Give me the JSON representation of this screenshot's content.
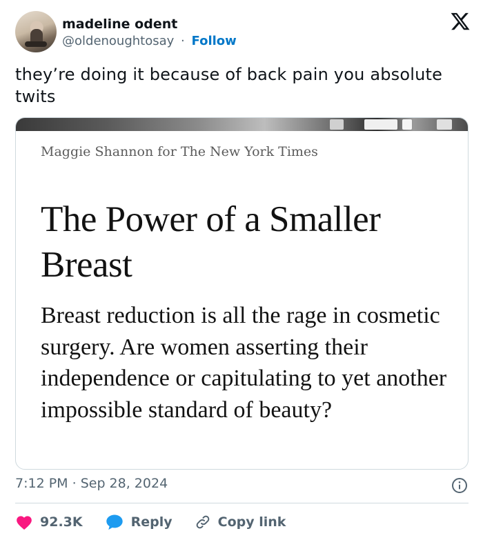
{
  "author": {
    "name": "madeline odent",
    "handle": "@oldenoughtosay",
    "separator": "·",
    "follow_label": "Follow"
  },
  "tweet": {
    "text": "they’re doing it because of back pain you absolute twits"
  },
  "card": {
    "photo_credit": "Maggie Shannon for The New York Times",
    "headline": "The Power of a Smaller Breast",
    "dek": "Breast reduction is all the rage in cosmetic surgery. Are women asserting their independence or capitulating to yet another impossible standard of beauty?"
  },
  "meta": {
    "time": "7:12 PM",
    "separator": "·",
    "date": "Sep 28, 2024"
  },
  "actions": {
    "likes_count": "92.3K",
    "reply_label": "Reply",
    "copy_link_label": "Copy link"
  },
  "icons": {
    "logo": "x-logo-icon",
    "like": "heart-icon",
    "reply": "speech-bubble-icon",
    "copy": "link-icon",
    "info": "info-icon"
  },
  "colors": {
    "heart": "#f91880",
    "reply_bubble": "#1d9bf0",
    "follow": "#0077c8",
    "secondary_text": "#536471"
  }
}
